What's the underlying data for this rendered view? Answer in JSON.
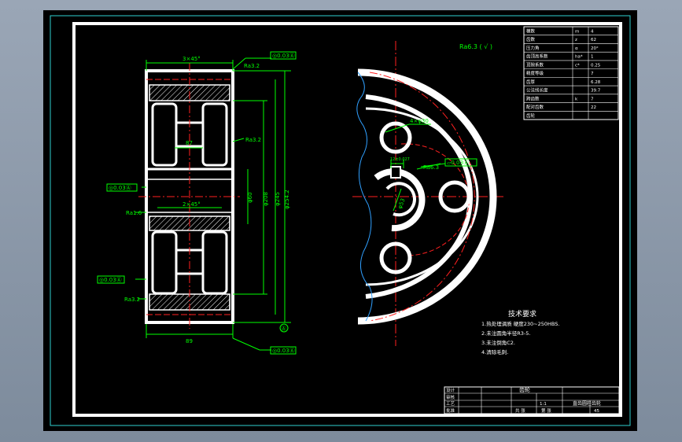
{
  "colors": {
    "paper": "#000000",
    "border": "#ffffff",
    "dim": "#00ff00",
    "center": "#ff2020",
    "frame": "#30d0d0",
    "hatch": "#ffffff"
  },
  "gear_section": {
    "chamfer_top": "3×45°",
    "chamfer_mid": "2×45°",
    "width_dim": "89",
    "hub_dim": "87",
    "datum": "Ⓐ",
    "callout_tol_top": "◎0.03Ⓐ",
    "callout_tol_mid": "◎0.03Ⓐ",
    "callout_tol_lower": "◎0.03Ⓐ",
    "callout_tol_bottom": "◎0.03Ⓐ",
    "roughness_1": "Ra3.2",
    "roughness_2": "Ra3.2",
    "roughness_3": "Ra1.6",
    "roughness_4": "Ra3.2",
    "vdim_1": "φ60",
    "vdim_2": "φ208",
    "vdim_3": "φ245",
    "vdim_4": "φ254.2"
  },
  "front_view": {
    "hole_label": "4×φ30",
    "key_dim": "12±0.027",
    "roughness": "Ra6.3",
    "tol": "▱0.03Ⓐ",
    "bore_dim": "φ53"
  },
  "surface_note": "Ra6.3 ( √ )",
  "param_table": {
    "rows": [
      [
        "模数",
        "m",
        "4"
      ],
      [
        "齿数",
        "z",
        "62"
      ],
      [
        "压力角",
        "α",
        "20°"
      ],
      [
        "齿顶高系数",
        "ha*",
        "1"
      ],
      [
        "顶隙系数",
        "c*",
        "0.25"
      ],
      [
        "精度等级",
        "",
        "7"
      ],
      [
        "齿厚",
        "",
        "6.28"
      ],
      [
        "公法线长度",
        "",
        "39.7"
      ],
      [
        "跨齿数",
        "k",
        "7"
      ],
      [
        "配对齿数",
        "",
        "22"
      ]
    ],
    "last_label": "齿轮"
  },
  "tech_req": {
    "title": "技术要求",
    "items": [
      "1.热处理调质 硬度230~250HBS.",
      "2.未注圆角半径R3-5.",
      "3.未注倒角C2.",
      "4.清除毛刺."
    ]
  },
  "title_block": {
    "part_name": "齿轮",
    "drawing_no": "直齿圆柱齿轮",
    "scale": "1:1",
    "labels": [
      "设计",
      "审核",
      "工艺",
      "批准"
    ],
    "qty": "共 张",
    "sheet": "第 张",
    "material": "45"
  }
}
